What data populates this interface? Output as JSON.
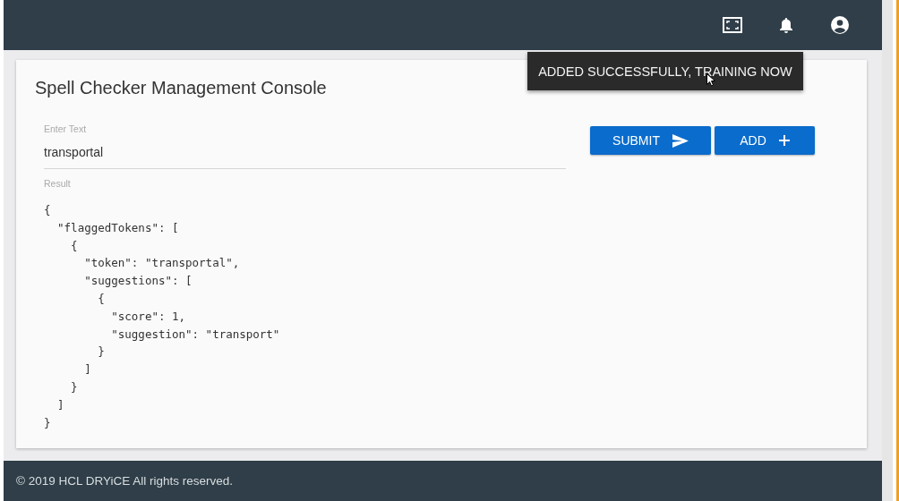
{
  "header": {
    "icons": [
      {
        "kind": "fullscreen"
      },
      {
        "kind": "bell"
      },
      {
        "kind": "account"
      }
    ]
  },
  "card": {
    "title": "Spell Checker Management Console",
    "input": {
      "label": "Enter Text",
      "value": "transportal"
    },
    "result": {
      "label": "Result",
      "text": "{\n  \"flaggedTokens\": [\n    {\n      \"token\": \"transportal\",\n      \"suggestions\": [\n        {\n          \"score\": 1,\n          \"suggestion\": \"transport\"\n        }\n      ]\n    }\n  ]\n}"
    },
    "buttons": [
      {
        "label": "SUBMIT",
        "kind": "send"
      },
      {
        "label": "ADD",
        "kind": "plus"
      }
    ]
  },
  "toast": {
    "text": "ADDED SUCCESSFULLY, TRAINING NOW"
  },
  "footer": {
    "text": "© 2019 HCL DRYiCE All rights reserved."
  }
}
